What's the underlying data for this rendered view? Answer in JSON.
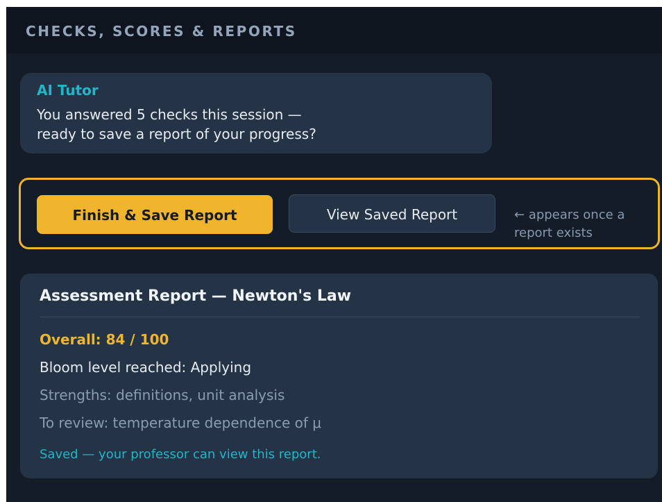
{
  "header": {
    "title": "CHECKS, SCORES & REPORTS"
  },
  "tutor_message": {
    "sender": "AI Tutor",
    "line1": "You answered 5 checks this session —",
    "line2": "ready to save a report of your progress?"
  },
  "actions": {
    "finish_label": "Finish & Save Report",
    "view_label": "View Saved Report",
    "hint": "← appears once a report exists"
  },
  "report": {
    "title": "Assessment Report — Newton's Law",
    "overall": "Overall: 84 / 100",
    "bloom": "Bloom level reached: Applying",
    "strengths": "Strengths: definitions, unit analysis",
    "review": "To review: temperature dependence of μ",
    "saved_status": "Saved — your professor can view this report."
  },
  "colors": {
    "accent": "#f0b52c",
    "tutor": "#22b5c9",
    "panel": "#243446",
    "background": "#141c27"
  }
}
